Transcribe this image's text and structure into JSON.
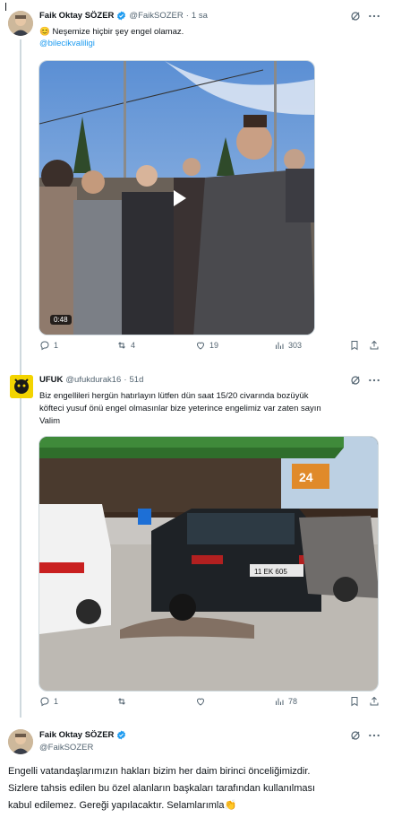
{
  "tweet1": {
    "name": "Faik Oktay SÖZER",
    "handle": "@FaikSOZER",
    "dot": "·",
    "time": "1 sa",
    "text": "😊 Neşemize hiçbir şey engel olamaz.",
    "mention": "@bilecikvaliligi",
    "video_duration": "0:48",
    "stats": {
      "replies": "1",
      "reposts": "4",
      "likes": "19",
      "views": "303"
    }
  },
  "tweet2": {
    "name": "UFUK",
    "handle": "@ufukdurak16",
    "dot": "·",
    "time": "51d",
    "text_line1": "Biz engellileri hergün hatırlayın lütfen dün saat 15/20 civarında bozüyük",
    "text_line2": "köfteci yusuf önü engel olmasınlar bize yeterince engelimiz var zaten sayın",
    "text_line3": "Valim",
    "store_sign": "24",
    "plate": "11 EK 605",
    "stats": {
      "replies": "1",
      "reposts": "",
      "likes": "",
      "views": "78"
    }
  },
  "tweet3": {
    "name": "Faik Oktay SÖZER",
    "handle": "@FaikSOZER",
    "text_line1": "Engelli vatandaşlarımızın hakları bizim her daim birinci önceliğimizdir.",
    "text_line2": "Sizlere tahsis edilen bu özel alanların başkaları tarafından kullanılması",
    "text_line3": "kabul edilemez. Gereği yapılacaktır. Selamlarımla👏"
  },
  "colors": {
    "accent": "#1d9bf0",
    "text": "#0f1419",
    "muted": "#536471",
    "border": "#cfd9de"
  },
  "icons": [
    "grok-icon",
    "more-icon",
    "reply-icon",
    "repost-icon",
    "like-icon",
    "views-icon",
    "bookmark-icon",
    "share-icon",
    "verified-icon",
    "play-icon"
  ]
}
